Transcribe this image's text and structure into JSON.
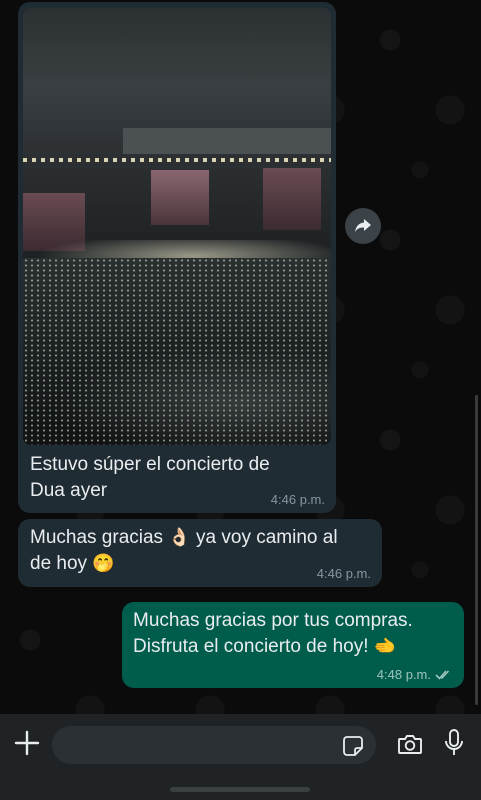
{
  "messages": [
    {
      "type": "image",
      "direction": "incoming",
      "caption": "Estuvo súper el concierto de Dua ayer",
      "caption_line1": "Estuvo súper el concierto de",
      "caption_line2": "Dua ayer",
      "time": "4:46 p.m."
    },
    {
      "type": "text",
      "direction": "incoming",
      "line1_a": "Muchas gracias",
      "emoji1": "👌🏻",
      "line1_b": "ya voy camino al",
      "line2_a": "de hoy",
      "emoji2": "🤭",
      "time": "4:46 p.m."
    },
    {
      "type": "text",
      "direction": "outgoing",
      "line1": "Muchas gracias por tus compras.",
      "line2": "Disfruta el concierto de hoy!",
      "emoji": "🫲",
      "time": "4:48 p.m.",
      "status": "read"
    }
  ],
  "icons": {
    "share": "forward-icon",
    "attach": "plus-icon",
    "sticker": "sticker-icon",
    "camera": "camera-icon",
    "mic": "mic-icon"
  },
  "colors": {
    "incoming_bubble": "#202c33",
    "outgoing_bubble": "#005c4b",
    "accent_read_ticks": "#53bdeb"
  }
}
